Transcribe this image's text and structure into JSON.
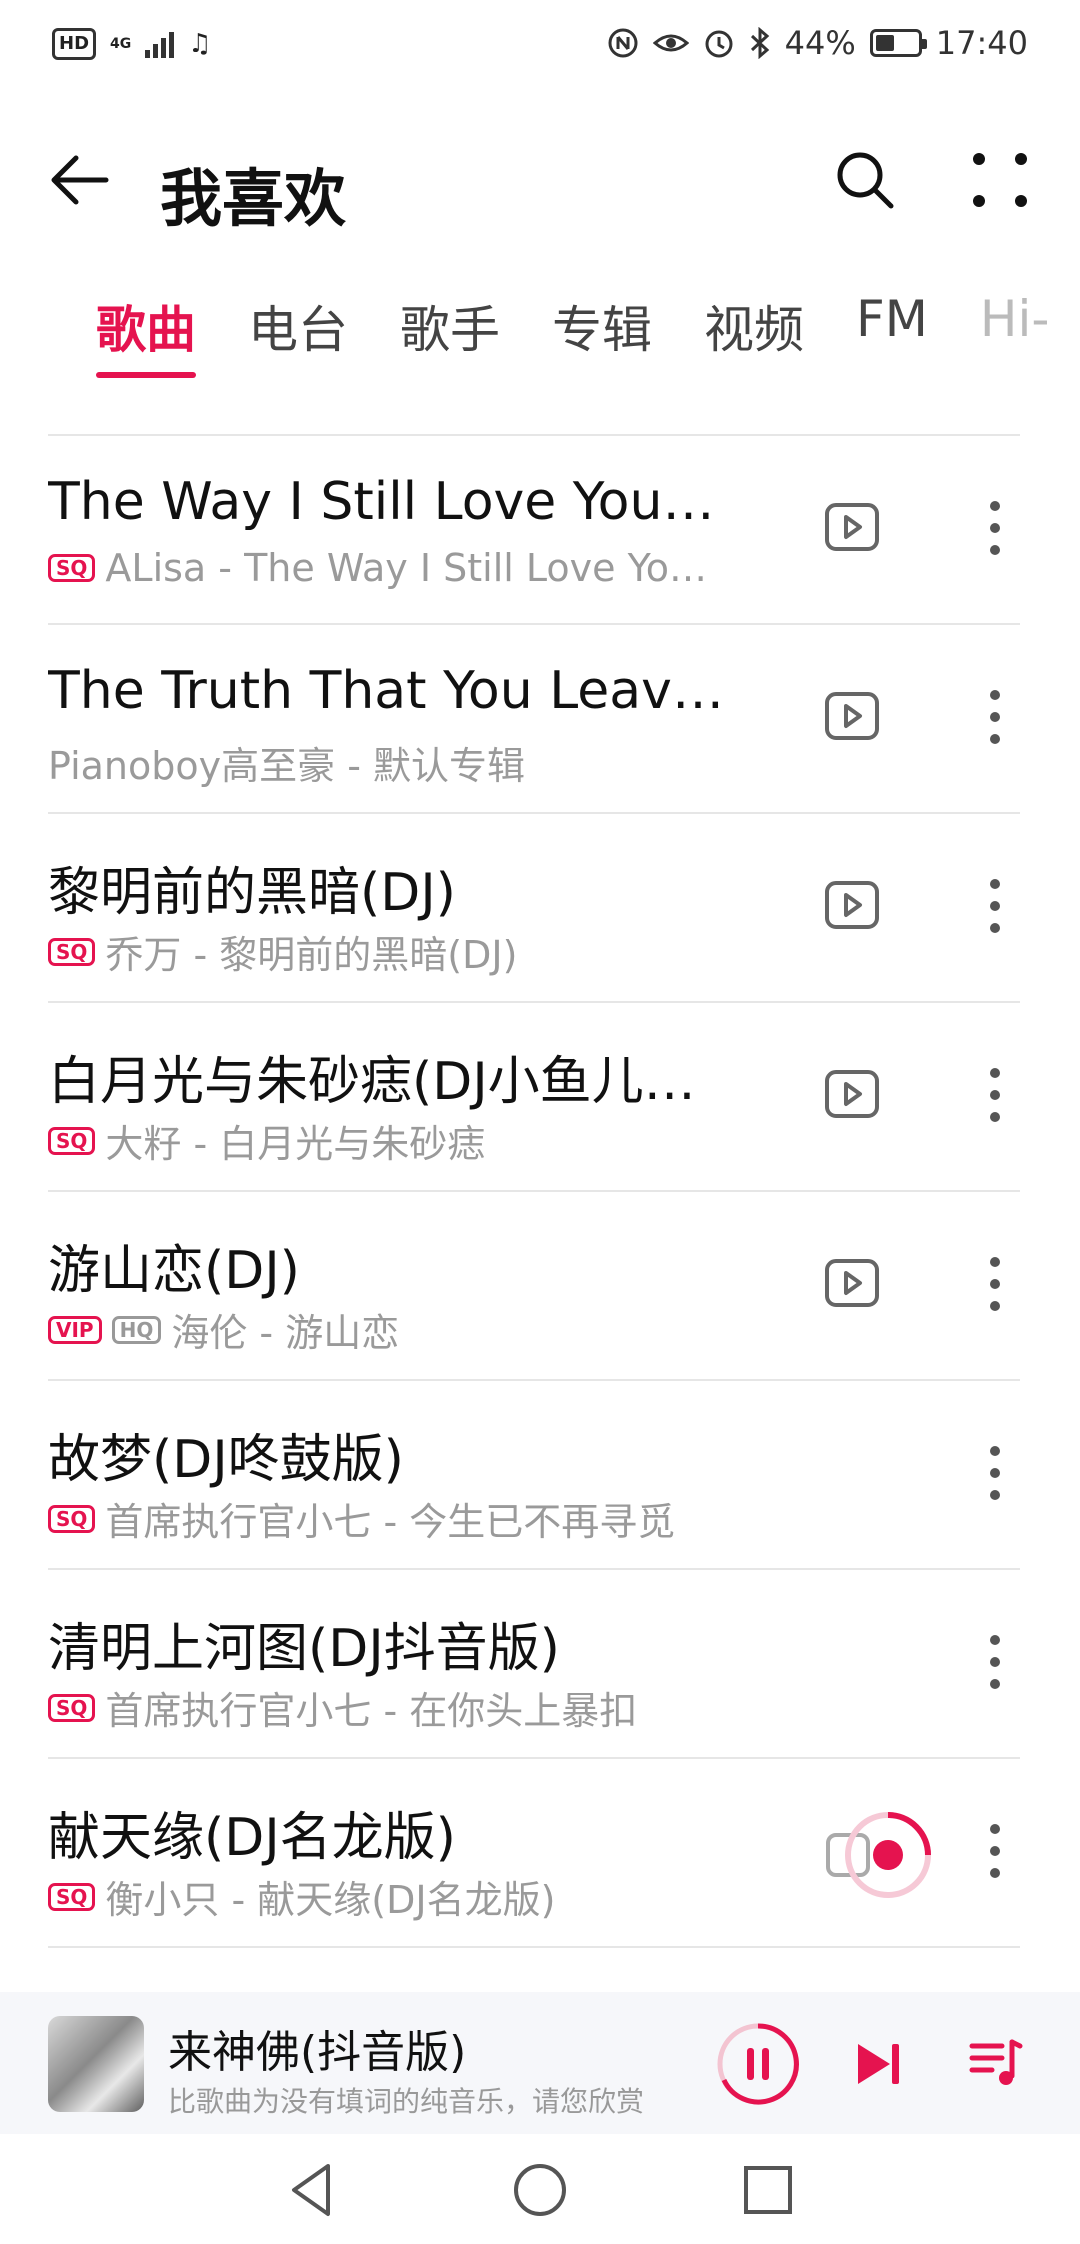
{
  "status_bar": {
    "left_badge": "HD",
    "network": "4G",
    "music_note": "♫",
    "battery": "44%",
    "battery_level": 0.44,
    "time": "17:40"
  },
  "header": {
    "title": "我喜欢"
  },
  "tabs": [
    {
      "label": "歌曲",
      "active": true
    },
    {
      "label": "电台"
    },
    {
      "label": "歌手"
    },
    {
      "label": "专辑"
    },
    {
      "label": "视频"
    },
    {
      "label": "FM"
    },
    {
      "label": "Hi-"
    }
  ],
  "songs": [
    {
      "title": "The Way I Still Love You(…",
      "badges": [
        "SQ"
      ],
      "subtitle": "ALisa - The Way I Still Love You(…",
      "has_mv": true
    },
    {
      "title": "The Truth That You Leave…",
      "badges": [],
      "subtitle": "Pianoboy高至豪 - 默认专辑",
      "has_mv": true
    },
    {
      "title": "黎明前的黑暗(DJ)",
      "badges": [
        "SQ"
      ],
      "subtitle": "乔万 - 黎明前的黑暗(DJ)",
      "has_mv": true
    },
    {
      "title": "白月光与朱砂痣(DJ小鱼儿…",
      "badges": [
        "SQ"
      ],
      "subtitle": "大籽 - 白月光与朱砂痣",
      "has_mv": true
    },
    {
      "title": "游山恋(DJ)",
      "badges": [
        "VIP",
        "HQ"
      ],
      "subtitle": "海伦 - 游山恋",
      "has_mv": true
    },
    {
      "title": "故梦(DJ咚鼓版)",
      "badges": [
        "SQ"
      ],
      "subtitle": "首席执行官小七 - 今生已不再寻觅",
      "has_mv": false
    },
    {
      "title": "清明上河图(DJ抖音版)",
      "badges": [
        "SQ"
      ],
      "subtitle": "首席执行官小七 - 在你头上暴扣",
      "has_mv": false
    },
    {
      "title": "献天缘(DJ名龙版)",
      "badges": [
        "SQ"
      ],
      "subtitle": "衡小只 - 献天缘(DJ名龙版)",
      "has_mv": true,
      "now_playing": true
    }
  ],
  "player": {
    "title": "来神佛(抖音版)",
    "subtitle": "比歌曲为没有填词的纯音乐，请您欣赏"
  },
  "colors": {
    "accent": "#e5134f",
    "secondary_text": "#9a9a9a"
  }
}
